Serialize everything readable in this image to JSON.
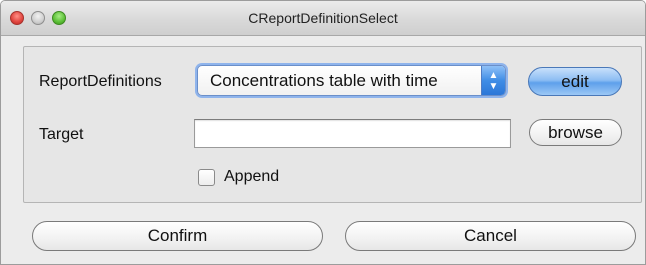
{
  "window": {
    "title": "CReportDefinitionSelect"
  },
  "form": {
    "report_definitions_label": "ReportDefinitions",
    "report_definitions_value": "Concentrations table with time",
    "edit_label": "edit",
    "target_label": "Target",
    "target_value": "",
    "browse_label": "browse",
    "append_label": "Append",
    "append_checked": false
  },
  "footer": {
    "confirm_label": "Confirm",
    "cancel_label": "Cancel"
  },
  "icons": {
    "select_arrows": "up-down-chevron-icon",
    "window_controls": [
      "close-icon",
      "minimize-icon",
      "zoom-icon"
    ]
  },
  "colors": {
    "accent_blue": "#5ea0eb",
    "close_red": "#e0443e",
    "zoom_green": "#5bbf36"
  }
}
